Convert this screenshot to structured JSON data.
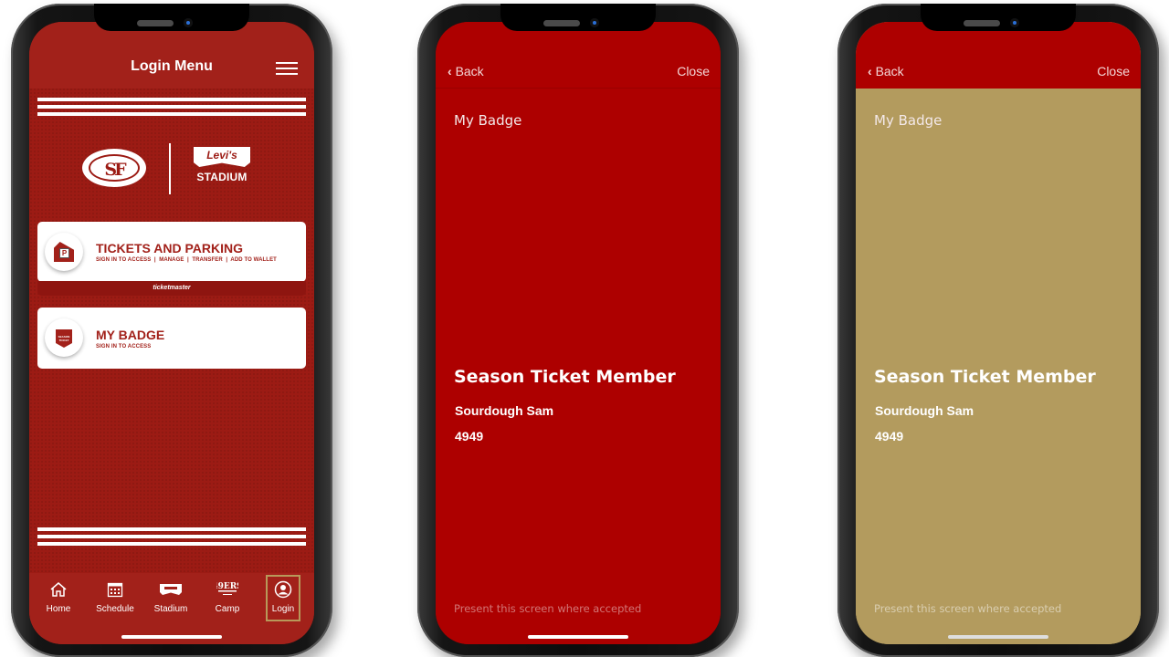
{
  "phones": {
    "login": {
      "header": {
        "title": "Login Menu",
        "menu_icon": "hamburger-icon"
      },
      "logos": {
        "team_logo": "SF",
        "stadium_brand": "Levi's",
        "stadium_label": "STADIUM"
      },
      "cards": [
        {
          "icon": "parking-ticket-icon",
          "title": "TICKETS AND PARKING",
          "subtitle": "SIGN IN TO ACCESS  |  MANAGE  |  TRANSFER  |  ADD TO WALLET",
          "footer": "ticketmaster"
        },
        {
          "icon": "season-ticket-badge-icon",
          "title": "MY BADGE",
          "subtitle": "SIGN IN TO ACCESS",
          "badge_text": "SEASON TICKET"
        }
      ],
      "tabbar": [
        {
          "label": "Home",
          "icon": "home-icon",
          "active": false
        },
        {
          "label": "Schedule",
          "icon": "calendar-icon",
          "active": false
        },
        {
          "label": "Stadium",
          "icon": "levis-logo-icon",
          "active": false
        },
        {
          "label": "Camp",
          "icon": "49ers-camp-logo-icon",
          "active": false
        },
        {
          "label": "Login",
          "icon": "user-circle-icon",
          "active": true
        }
      ]
    },
    "badge_red": {
      "nav": {
        "back": "Back",
        "close": "Close"
      },
      "section_label": "My Badge",
      "membership": "Season Ticket Member",
      "member_name": "Sourdough Sam",
      "member_number": "4949",
      "footer_note": "Present this screen where accepted",
      "background_color": "#ad0000"
    },
    "badge_gold": {
      "nav": {
        "back": "Back",
        "close": "Close"
      },
      "section_label": "My Badge",
      "membership": "Season Ticket Member",
      "member_name": "Sourdough Sam",
      "member_number": "4949",
      "footer_note": "Present this screen where accepted",
      "background_color": "#b39b5e"
    }
  },
  "colors": {
    "primary_red": "#9c1b14",
    "badge_red": "#ad0000",
    "badge_gold": "#b39b5e",
    "active_tab_border": "#b8995a"
  }
}
